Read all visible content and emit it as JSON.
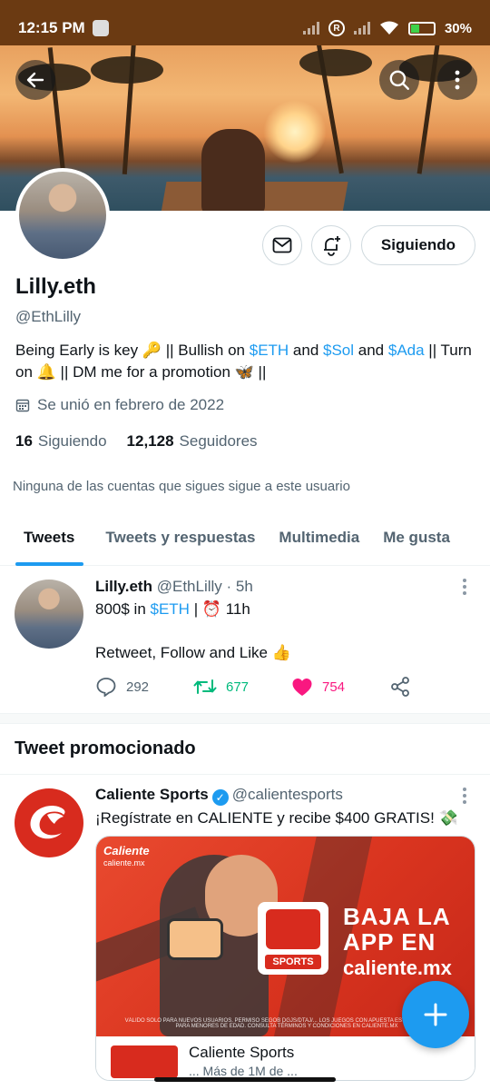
{
  "status_bar": {
    "time": "12:15 PM",
    "battery": "30%",
    "icons": [
      "photo-icon",
      "signal-icon",
      "r-badge-icon",
      "signal-icon",
      "wifi-icon",
      "battery-charging-icon"
    ]
  },
  "header": {
    "back_icon": "arrow-left-icon",
    "search_icon": "search-icon",
    "more_icon": "more-vertical-icon"
  },
  "profile": {
    "display_name": "Lilly.eth",
    "handle": "@EthLilly",
    "bio": {
      "p1": "Being Early is key ",
      "emoji_key": "🔑",
      "p2": " || Bullish on ",
      "eth": "$ETH",
      "and1": " and ",
      "sol": "$Sol",
      "and2": " and ",
      "ada": "$Ada",
      "p3": " || Turn on ",
      "emoji_bell": "🔔",
      "p4": " || DM me for a promotion ",
      "emoji_butterfly": "🦋",
      "p5": " ||"
    },
    "joined": "Se unió en febrero de 2022",
    "following_count": "16",
    "following_label": "Siguiendo",
    "followers_count": "12,128",
    "followers_label": "Seguidores",
    "no_common_followers": "Ninguna de las cuentas que sigues sigue a este usuario",
    "follow_button": "Siguiendo"
  },
  "tabs": [
    {
      "label": "Tweets",
      "active": true
    },
    {
      "label": "Tweets y respuestas",
      "active": false
    },
    {
      "label": "Multimedia",
      "active": false
    },
    {
      "label": "Me gusta",
      "active": false
    }
  ],
  "tweet": {
    "name": "Lilly.eth",
    "handle_time": "@EthLilly · 5h",
    "line1_a": "800$ in ",
    "line1_eth": "$ETH",
    "line1_b": " | ",
    "line1_emoji": "⏰",
    "line1_c": " 11h",
    "line2": "Retweet, Follow and Like ",
    "line2_emoji": "👍",
    "replies": "292",
    "retweets": "677",
    "likes": "754",
    "colors": {
      "retweet": "#00ba7c",
      "like": "#f91880"
    }
  },
  "promoted": {
    "section_title": "Tweet promocionado",
    "name": "Caliente Sports",
    "handle": "@calientesports",
    "text": "¡Regístrate en CALIENTE y recibe $400 GRATIS! ",
    "text_emoji": "💸",
    "card": {
      "brand": "Caliente",
      "brand_sub": "caliente.mx",
      "logo_label": "SPORTS",
      "headline_1": "BAJA LA",
      "headline_2": "APP EN",
      "domain": "caliente.mx",
      "fineprint": "VÁLIDO SÓLO PARA NUEVOS USUARIOS. PERMISO SEGOB DGJS/DTAJ/... LOS JUEGOS CON APUESTA ESTÁN PROHIBIDOS PARA MENORES DE EDAD. CONSULTA TÉRMINOS Y CONDICIONES EN CALIENTE.MX",
      "footer_title": "Caliente Sports",
      "footer_sub": "... Más de 1M de ..."
    }
  },
  "accent_color": "#1d9bf0"
}
